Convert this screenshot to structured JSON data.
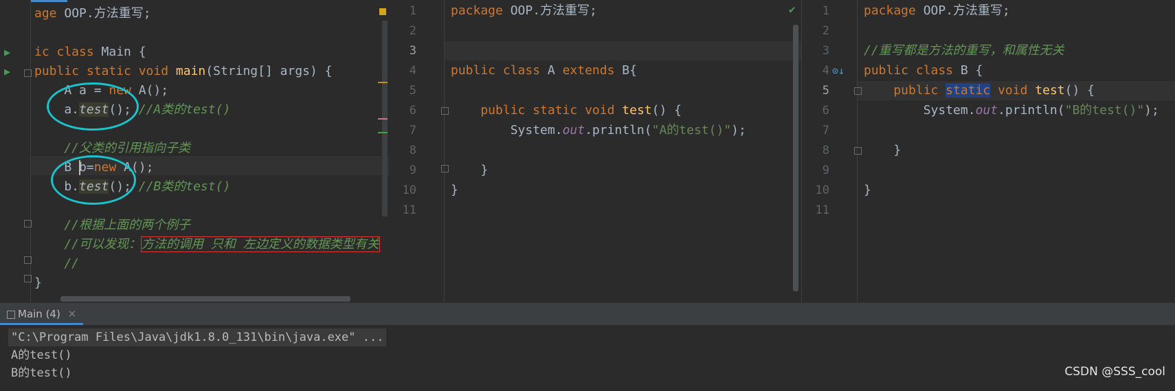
{
  "colors": {
    "keyword": "#cc7832",
    "method": "#ffc66d",
    "string": "#6a8759",
    "comment": "#629755",
    "static_field": "#9876aa",
    "annotation_circle": "#19c4cc",
    "annotation_box": "#e03838"
  },
  "left_editor": {
    "l1_kw": "age",
    "l1_rest": " OOP.方法重写;",
    "l3_kw": "ic class",
    "l3_rest": " Main {",
    "l4_a": "public static void",
    "l4_fn": "main",
    "l4_rest": "(String[] args) {",
    "l5_a": "    A a = ",
    "l5_kw": "new",
    "l5_b": " A();",
    "l6_a": "    a.",
    "l6_m": "test",
    "l6_b": "(); ",
    "l6_c": "//A类的test()",
    "l8": "    //父类的引用指向子类",
    "l9_a": "    B b=",
    "l9_kw": "new",
    "l9_b": " A();",
    "l10_a": "    b.",
    "l10_m": "test",
    "l10_b": "(); ",
    "l10_c": "//B类的test()",
    "l12": "    //根据上面的两个例子",
    "l13_a": "    //可以发现：",
    "l13_box": "方法的调用 只和 左边定义的数据类型有关",
    "l14": "    //",
    "l15": "}"
  },
  "middle_editor": {
    "line_numbers": [
      "1",
      "2",
      "3",
      "4",
      "5",
      "6",
      "7",
      "8",
      "9",
      "10",
      "11"
    ],
    "l1_kw": "package",
    "l1_rest": " OOP.方法重写;",
    "l4_kw": "public class",
    "l4_a": " A ",
    "l4_kw2": "extends",
    "l4_b": " B{",
    "l6_kw": "    public static void",
    "l6_fn": "test",
    "l6_rest": "() {",
    "l7_a": "        System.",
    "l7_stat": "out",
    "l7_b": ".println(",
    "l7_str": "\"A的test()\"",
    "l7_c": ");",
    "l9": "    }",
    "l10": "}"
  },
  "right_editor": {
    "line_numbers": [
      "1",
      "2",
      "3",
      "4",
      "5",
      "6",
      "7",
      "8",
      "9",
      "10",
      "11"
    ],
    "l1_kw": "package",
    "l1_rest": " OOP.方法重写;",
    "l3": "//重写都是方法的重写，和属性无关",
    "l4_kw": "public class",
    "l4_rest": " B {",
    "l5_kw": "    public",
    "l5_sel": "static",
    "l5_kw2": "void",
    "l5_fn": "test",
    "l5_rest": "() {",
    "l6_a": "        System.",
    "l6_stat": "out",
    "l6_b": ".println(",
    "l6_str": "\"B的test()\"",
    "l6_c": ");",
    "l8": "    }",
    "l10": "}"
  },
  "console": {
    "tab_label": "Main (4)",
    "command": "\"C:\\Program Files\\Java\\jdk1.8.0_131\\bin\\java.exe\" ...",
    "output": [
      "A的test()",
      "B的test()"
    ]
  },
  "watermark": "CSDN @SSS_cool"
}
